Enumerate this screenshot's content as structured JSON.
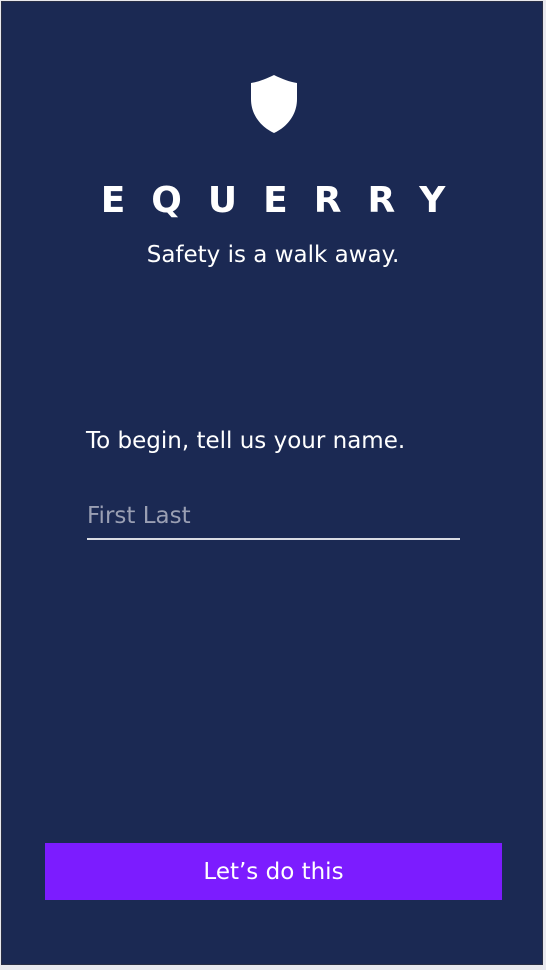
{
  "app": {
    "logo_icon": "shield-icon",
    "brand_name": "EQUERRY",
    "tagline": "Safety is a walk away."
  },
  "form": {
    "prompt": "To begin, tell us your name.",
    "name_placeholder": "First Last",
    "name_value": ""
  },
  "actions": {
    "primary_label": "Let’s do this"
  },
  "colors": {
    "background": "#1b2953",
    "accent": "#7c1cff",
    "text": "#ffffff",
    "placeholder": "#9a9fb3"
  }
}
